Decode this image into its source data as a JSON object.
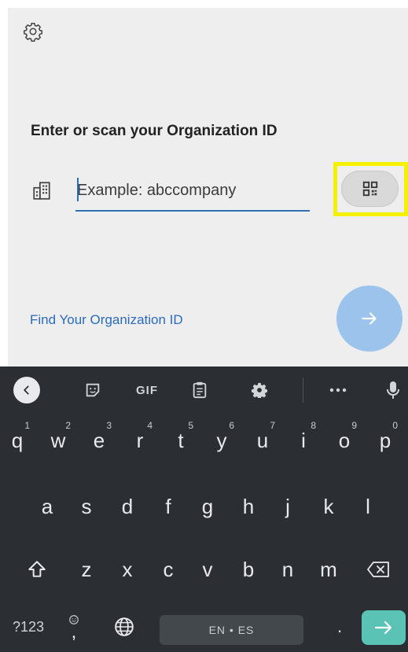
{
  "app": {
    "heading": "Enter or scan your Organization ID",
    "org_input": {
      "placeholder": "Example: abccompany",
      "value": ""
    },
    "find_link": "Find Your Organization ID",
    "colors": {
      "accent": "#2f6fb5",
      "link": "#2a6bbf",
      "next_button": "#9cc3ec",
      "highlight": "#f4f000"
    },
    "icons": {
      "settings": "gear-icon",
      "organization": "building-icon",
      "scan": "qr-code-icon",
      "next": "arrow-right-icon"
    }
  },
  "keyboard": {
    "toolbar": {
      "gif": "GIF",
      "icons": [
        "chevron-left-icon",
        "sticker-icon",
        "gif-icon",
        "clipboard-icon",
        "gear-icon",
        "more-icon",
        "microphone-icon"
      ]
    },
    "row1": [
      {
        "key": "q",
        "hint": "1"
      },
      {
        "key": "w",
        "hint": "2"
      },
      {
        "key": "e",
        "hint": "3"
      },
      {
        "key": "r",
        "hint": "4"
      },
      {
        "key": "t",
        "hint": "5"
      },
      {
        "key": "y",
        "hint": "6"
      },
      {
        "key": "u",
        "hint": "7"
      },
      {
        "key": "i",
        "hint": "8"
      },
      {
        "key": "o",
        "hint": "9"
      },
      {
        "key": "p",
        "hint": "0"
      }
    ],
    "row2": [
      "a",
      "s",
      "d",
      "f",
      "g",
      "h",
      "j",
      "k",
      "l"
    ],
    "row3": [
      "z",
      "x",
      "c",
      "v",
      "b",
      "n",
      "m"
    ],
    "row4": {
      "symbols": "?123",
      "comma": ",",
      "space": "EN • ES",
      "period": "."
    },
    "colors": {
      "background": "#2b2f33",
      "enter": "#5bc2b6"
    }
  }
}
